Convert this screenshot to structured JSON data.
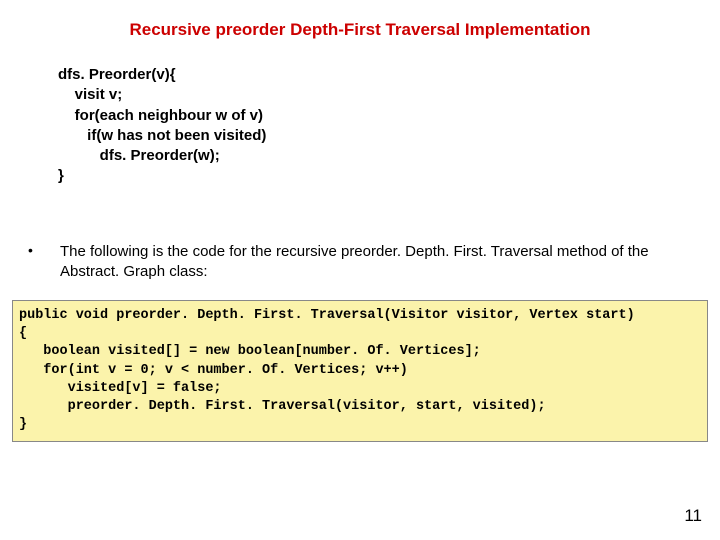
{
  "title": "Recursive preorder Depth-First Traversal Implementation",
  "pseudo": "dfs. Preorder(v){\n    visit v;\n    for(each neighbour w of v)\n       if(w has not been visited)\n          dfs. Preorder(w);\n}",
  "bullet": {
    "marker": "•",
    "text": "The following is the code for the recursive preorder. Depth. First. Traversal method of the Abstract. Graph class:"
  },
  "code": "public void preorder. Depth. First. Traversal(Visitor visitor, Vertex start)\n{\n   boolean visited[] = new boolean[number. Of. Vertices];\n   for(int v = 0; v < number. Of. Vertices; v++)\n      visited[v] = false;\n      preorder. Depth. First. Traversal(visitor, start, visited);\n}",
  "page_number": "11"
}
